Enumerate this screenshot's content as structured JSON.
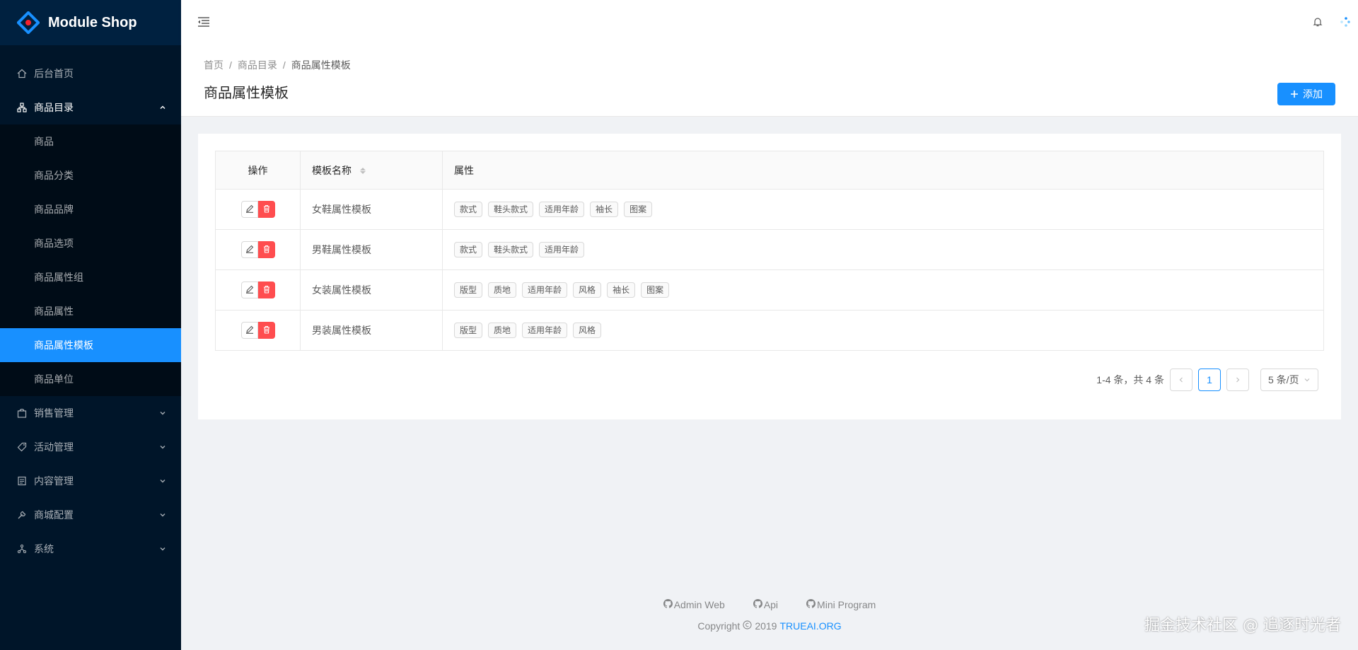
{
  "app": {
    "title": "Module Shop"
  },
  "sidebar": {
    "items": [
      {
        "label": "后台首页",
        "icon": "home-icon"
      },
      {
        "label": "商品目录",
        "icon": "cluster-icon",
        "open": true
      },
      {
        "label": "销售管理",
        "icon": "shopping-bag-icon"
      },
      {
        "label": "活动管理",
        "icon": "tag-icon"
      },
      {
        "label": "内容管理",
        "icon": "file-text-icon"
      },
      {
        "label": "商城配置",
        "icon": "tool-icon"
      },
      {
        "label": "系统",
        "icon": "apartment-icon"
      }
    ],
    "submenu": [
      "商品",
      "商品分类",
      "商品品牌",
      "商品选项",
      "商品属性组",
      "商品属性",
      "商品属性模板",
      "商品单位"
    ],
    "selected": "商品属性模板"
  },
  "breadcrumb": [
    "首页",
    "商品目录",
    "商品属性模板"
  ],
  "page": {
    "title": "商品属性模板",
    "add_label": "添加"
  },
  "table": {
    "columns": [
      "操作",
      "模板名称",
      "属性"
    ],
    "rows": [
      {
        "name": "女鞋属性模板",
        "attrs": [
          "款式",
          "鞋头款式",
          "适用年龄",
          "袖长",
          "图案"
        ]
      },
      {
        "name": "男鞋属性模板",
        "attrs": [
          "款式",
          "鞋头款式",
          "适用年龄"
        ]
      },
      {
        "name": "女装属性模板",
        "attrs": [
          "版型",
          "质地",
          "适用年龄",
          "风格",
          "袖长",
          "图案"
        ]
      },
      {
        "name": "男装属性模板",
        "attrs": [
          "版型",
          "质地",
          "适用年龄",
          "风格"
        ]
      }
    ]
  },
  "pagination": {
    "total_text": "1-4 条，共 4 条",
    "current": "1",
    "page_size": "5 条/页"
  },
  "footer": {
    "links": [
      "Admin Web",
      "Api",
      "Mini Program"
    ],
    "copyright": "Copyright",
    "year": "2019",
    "brand": "TRUEAI.ORG"
  },
  "watermark": "掘金技术社区 @ 追逐时光者",
  "colors": {
    "primary": "#1890ff",
    "danger": "#ff4d4f",
    "sider": "#001529"
  }
}
